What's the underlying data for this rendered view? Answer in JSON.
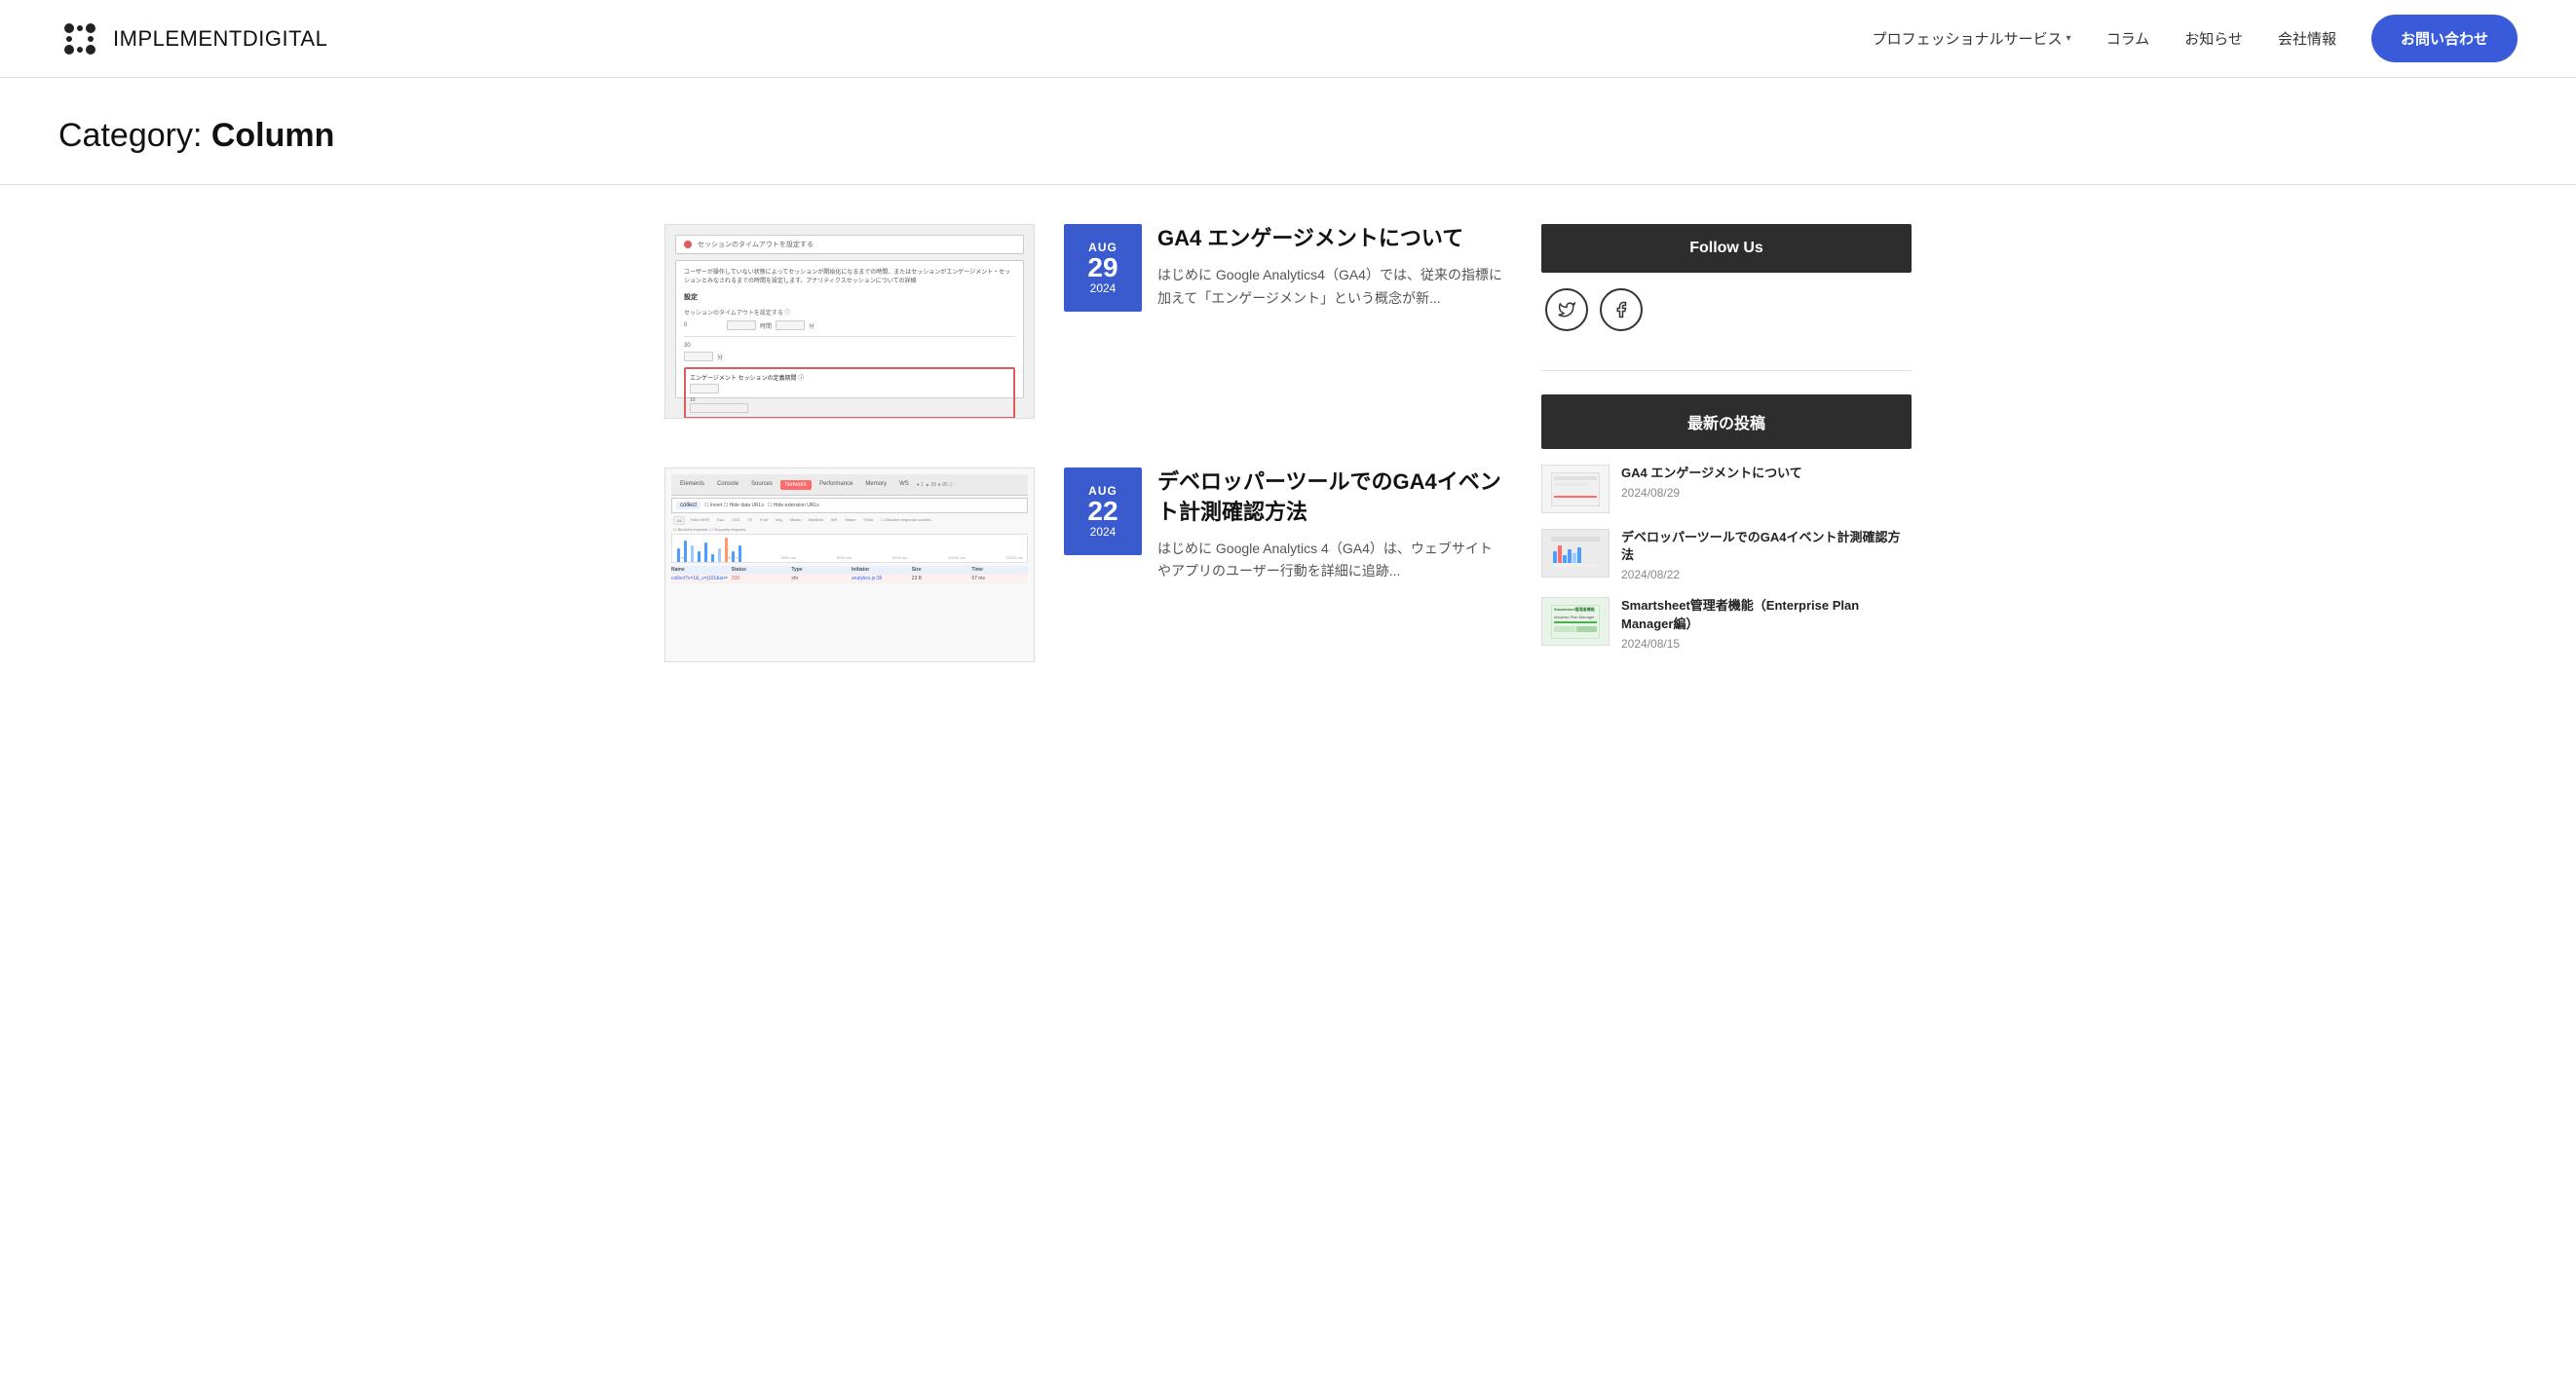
{
  "header": {
    "logo_text_bold": "IMPLEMENT",
    "logo_text_light": "DIGITAL",
    "nav": [
      {
        "label": "プロフェッショナルサービス",
        "has_dropdown": true
      },
      {
        "label": "コラム",
        "has_dropdown": false
      },
      {
        "label": "お知らせ",
        "has_dropdown": false
      },
      {
        "label": "会社情報",
        "has_dropdown": false
      }
    ],
    "cta_button": "お問い合わせ"
  },
  "category": {
    "prefix": "Category:",
    "name": "Column"
  },
  "articles": [
    {
      "month": "AUG",
      "day": "29",
      "year": "2024",
      "title": "GA4 エンゲージメントについて",
      "excerpt": "はじめに Google Analytics4（GA4）では、従来の指標に加えて「エンゲージメント」という概念が新..."
    },
    {
      "month": "AUG",
      "day": "22",
      "year": "2024",
      "title": "デベロッパーツールでのGA4イベント計測確認方法",
      "excerpt": "はじめに Google Analytics 4（GA4）は、ウェブサイトやアプリのユーザー行動を詳細に追跡..."
    }
  ],
  "sidebar": {
    "follow_us_title": "Follow Us",
    "twitter_label": "Twitter",
    "facebook_label": "Facebook",
    "recent_posts_title": "最新の投稿",
    "recent_posts": [
      {
        "title": "GA4 エンゲージメントについて",
        "date": "2024/08/29",
        "thumb_type": "ga4"
      },
      {
        "title": "デベロッパーツールでのGA4イベント計測確認方法",
        "date": "2024/08/22",
        "thumb_type": "devtools"
      },
      {
        "title": "Smartsheet管理者機能（Enterprise Plan Manager編）",
        "date": "2024/08/15",
        "thumb_type": "smartsheet"
      }
    ]
  }
}
